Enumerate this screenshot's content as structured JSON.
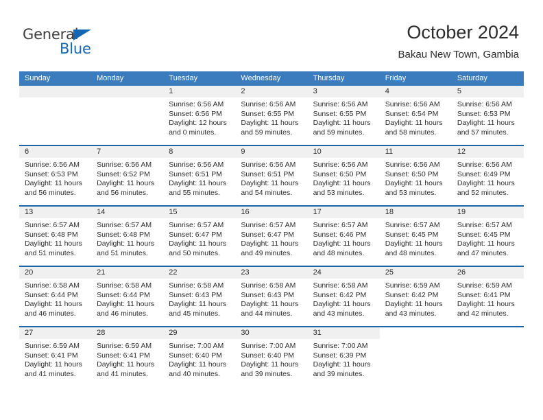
{
  "brand": {
    "name_top": "General",
    "name_bottom": "Blue",
    "color_blue": "#1567b3",
    "color_dark": "#3d3d3d"
  },
  "header": {
    "month_title": "October 2024",
    "location": "Bakau New Town, Gambia"
  },
  "theme": {
    "header_blue": "#3a7cbe",
    "separator_blue": "#1c63a8",
    "daynum_band": "#f0f0f0"
  },
  "weekday_headers": [
    "Sunday",
    "Monday",
    "Tuesday",
    "Wednesday",
    "Thursday",
    "Friday",
    "Saturday"
  ],
  "weeks": [
    [
      {
        "day": "",
        "sunrise": "",
        "sunset": "",
        "daylight1": "",
        "daylight2": ""
      },
      {
        "day": "",
        "sunrise": "",
        "sunset": "",
        "daylight1": "",
        "daylight2": ""
      },
      {
        "day": "1",
        "sunrise": "Sunrise: 6:56 AM",
        "sunset": "Sunset: 6:56 PM",
        "daylight1": "Daylight: 12 hours",
        "daylight2": "and 0 minutes."
      },
      {
        "day": "2",
        "sunrise": "Sunrise: 6:56 AM",
        "sunset": "Sunset: 6:55 PM",
        "daylight1": "Daylight: 11 hours",
        "daylight2": "and 59 minutes."
      },
      {
        "day": "3",
        "sunrise": "Sunrise: 6:56 AM",
        "sunset": "Sunset: 6:55 PM",
        "daylight1": "Daylight: 11 hours",
        "daylight2": "and 59 minutes."
      },
      {
        "day": "4",
        "sunrise": "Sunrise: 6:56 AM",
        "sunset": "Sunset: 6:54 PM",
        "daylight1": "Daylight: 11 hours",
        "daylight2": "and 58 minutes."
      },
      {
        "day": "5",
        "sunrise": "Sunrise: 6:56 AM",
        "sunset": "Sunset: 6:53 PM",
        "daylight1": "Daylight: 11 hours",
        "daylight2": "and 57 minutes."
      }
    ],
    [
      {
        "day": "6",
        "sunrise": "Sunrise: 6:56 AM",
        "sunset": "Sunset: 6:53 PM",
        "daylight1": "Daylight: 11 hours",
        "daylight2": "and 56 minutes."
      },
      {
        "day": "7",
        "sunrise": "Sunrise: 6:56 AM",
        "sunset": "Sunset: 6:52 PM",
        "daylight1": "Daylight: 11 hours",
        "daylight2": "and 56 minutes."
      },
      {
        "day": "8",
        "sunrise": "Sunrise: 6:56 AM",
        "sunset": "Sunset: 6:51 PM",
        "daylight1": "Daylight: 11 hours",
        "daylight2": "and 55 minutes."
      },
      {
        "day": "9",
        "sunrise": "Sunrise: 6:56 AM",
        "sunset": "Sunset: 6:51 PM",
        "daylight1": "Daylight: 11 hours",
        "daylight2": "and 54 minutes."
      },
      {
        "day": "10",
        "sunrise": "Sunrise: 6:56 AM",
        "sunset": "Sunset: 6:50 PM",
        "daylight1": "Daylight: 11 hours",
        "daylight2": "and 53 minutes."
      },
      {
        "day": "11",
        "sunrise": "Sunrise: 6:56 AM",
        "sunset": "Sunset: 6:50 PM",
        "daylight1": "Daylight: 11 hours",
        "daylight2": "and 53 minutes."
      },
      {
        "day": "12",
        "sunrise": "Sunrise: 6:56 AM",
        "sunset": "Sunset: 6:49 PM",
        "daylight1": "Daylight: 11 hours",
        "daylight2": "and 52 minutes."
      }
    ],
    [
      {
        "day": "13",
        "sunrise": "Sunrise: 6:57 AM",
        "sunset": "Sunset: 6:48 PM",
        "daylight1": "Daylight: 11 hours",
        "daylight2": "and 51 minutes."
      },
      {
        "day": "14",
        "sunrise": "Sunrise: 6:57 AM",
        "sunset": "Sunset: 6:48 PM",
        "daylight1": "Daylight: 11 hours",
        "daylight2": "and 51 minutes."
      },
      {
        "day": "15",
        "sunrise": "Sunrise: 6:57 AM",
        "sunset": "Sunset: 6:47 PM",
        "daylight1": "Daylight: 11 hours",
        "daylight2": "and 50 minutes."
      },
      {
        "day": "16",
        "sunrise": "Sunrise: 6:57 AM",
        "sunset": "Sunset: 6:47 PM",
        "daylight1": "Daylight: 11 hours",
        "daylight2": "and 49 minutes."
      },
      {
        "day": "17",
        "sunrise": "Sunrise: 6:57 AM",
        "sunset": "Sunset: 6:46 PM",
        "daylight1": "Daylight: 11 hours",
        "daylight2": "and 48 minutes."
      },
      {
        "day": "18",
        "sunrise": "Sunrise: 6:57 AM",
        "sunset": "Sunset: 6:45 PM",
        "daylight1": "Daylight: 11 hours",
        "daylight2": "and 48 minutes."
      },
      {
        "day": "19",
        "sunrise": "Sunrise: 6:57 AM",
        "sunset": "Sunset: 6:45 PM",
        "daylight1": "Daylight: 11 hours",
        "daylight2": "and 47 minutes."
      }
    ],
    [
      {
        "day": "20",
        "sunrise": "Sunrise: 6:58 AM",
        "sunset": "Sunset: 6:44 PM",
        "daylight1": "Daylight: 11 hours",
        "daylight2": "and 46 minutes."
      },
      {
        "day": "21",
        "sunrise": "Sunrise: 6:58 AM",
        "sunset": "Sunset: 6:44 PM",
        "daylight1": "Daylight: 11 hours",
        "daylight2": "and 46 minutes."
      },
      {
        "day": "22",
        "sunrise": "Sunrise: 6:58 AM",
        "sunset": "Sunset: 6:43 PM",
        "daylight1": "Daylight: 11 hours",
        "daylight2": "and 45 minutes."
      },
      {
        "day": "23",
        "sunrise": "Sunrise: 6:58 AM",
        "sunset": "Sunset: 6:43 PM",
        "daylight1": "Daylight: 11 hours",
        "daylight2": "and 44 minutes."
      },
      {
        "day": "24",
        "sunrise": "Sunrise: 6:58 AM",
        "sunset": "Sunset: 6:42 PM",
        "daylight1": "Daylight: 11 hours",
        "daylight2": "and 43 minutes."
      },
      {
        "day": "25",
        "sunrise": "Sunrise: 6:59 AM",
        "sunset": "Sunset: 6:42 PM",
        "daylight1": "Daylight: 11 hours",
        "daylight2": "and 43 minutes."
      },
      {
        "day": "26",
        "sunrise": "Sunrise: 6:59 AM",
        "sunset": "Sunset: 6:41 PM",
        "daylight1": "Daylight: 11 hours",
        "daylight2": "and 42 minutes."
      }
    ],
    [
      {
        "day": "27",
        "sunrise": "Sunrise: 6:59 AM",
        "sunset": "Sunset: 6:41 PM",
        "daylight1": "Daylight: 11 hours",
        "daylight2": "and 41 minutes."
      },
      {
        "day": "28",
        "sunrise": "Sunrise: 6:59 AM",
        "sunset": "Sunset: 6:41 PM",
        "daylight1": "Daylight: 11 hours",
        "daylight2": "and 41 minutes."
      },
      {
        "day": "29",
        "sunrise": "Sunrise: 7:00 AM",
        "sunset": "Sunset: 6:40 PM",
        "daylight1": "Daylight: 11 hours",
        "daylight2": "and 40 minutes."
      },
      {
        "day": "30",
        "sunrise": "Sunrise: 7:00 AM",
        "sunset": "Sunset: 6:40 PM",
        "daylight1": "Daylight: 11 hours",
        "daylight2": "and 39 minutes."
      },
      {
        "day": "31",
        "sunrise": "Sunrise: 7:00 AM",
        "sunset": "Sunset: 6:39 PM",
        "daylight1": "Daylight: 11 hours",
        "daylight2": "and 39 minutes."
      },
      {
        "day": "",
        "sunrise": "",
        "sunset": "",
        "daylight1": "",
        "daylight2": ""
      },
      {
        "day": "",
        "sunrise": "",
        "sunset": "",
        "daylight1": "",
        "daylight2": ""
      }
    ]
  ]
}
